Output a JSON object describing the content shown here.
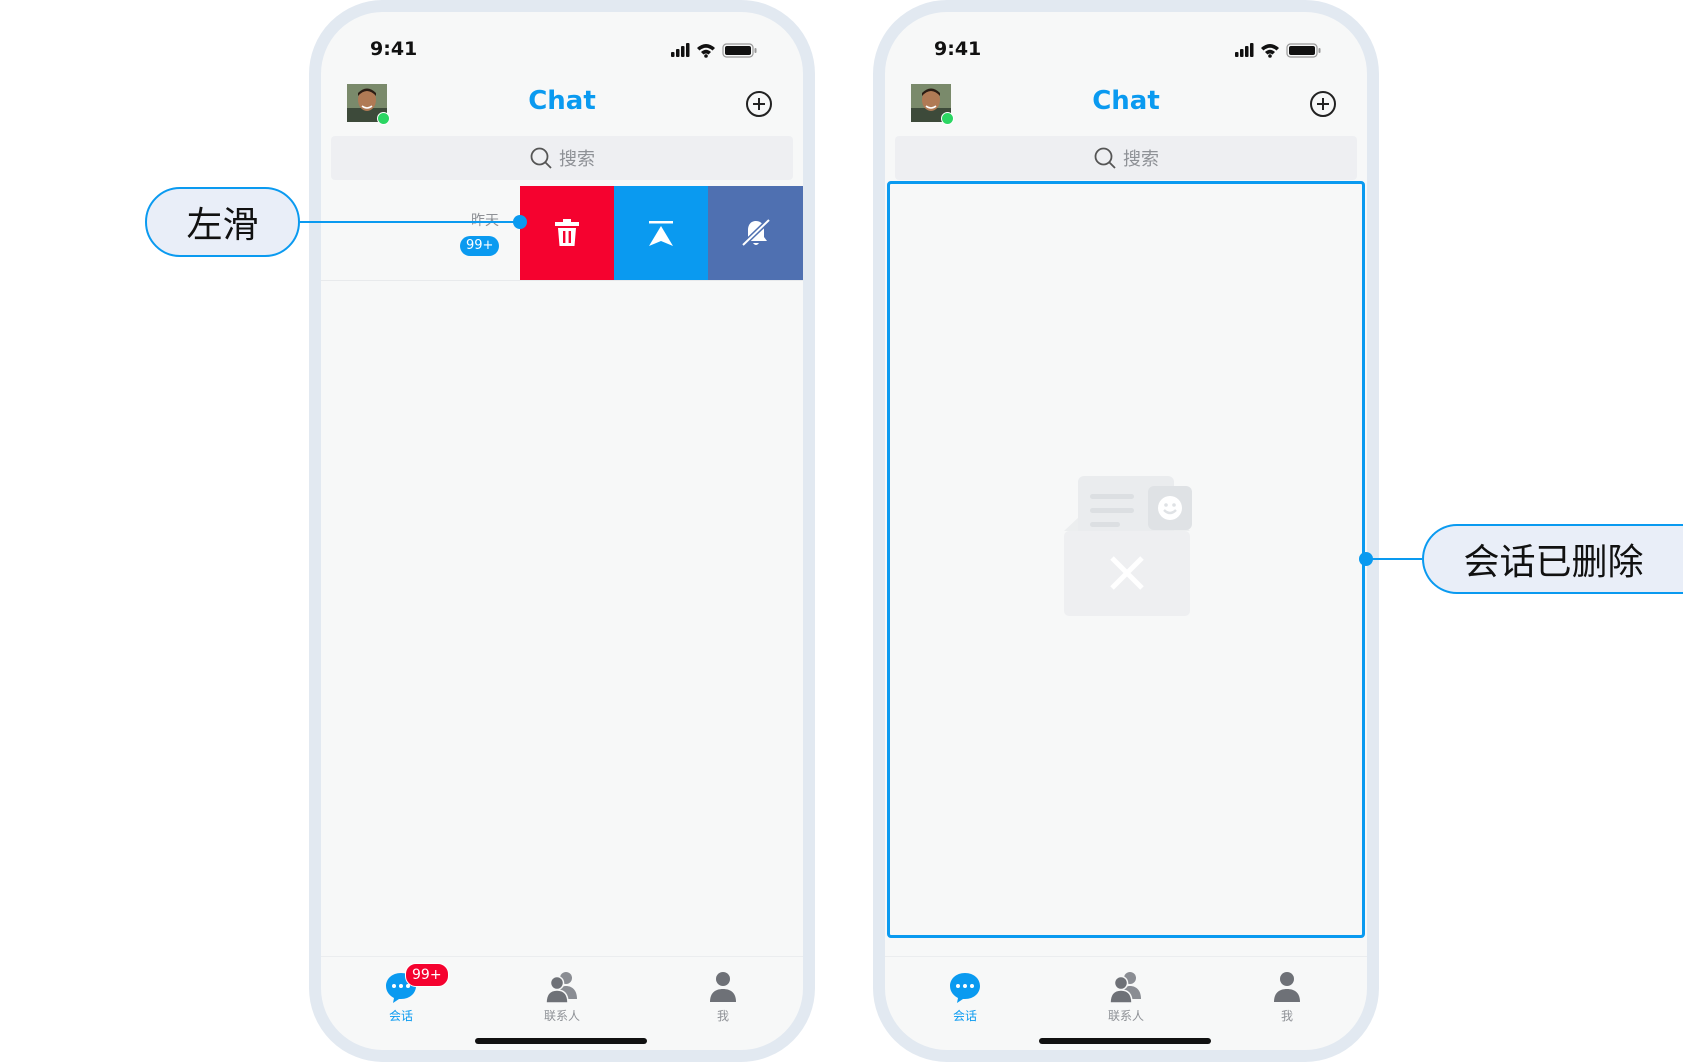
{
  "colors": {
    "accent": "#0a9af0",
    "delete": "#f5022f",
    "mute": "#4f70b1",
    "badge": "#f5022f",
    "online": "#2bd663"
  },
  "left_screen": {
    "status_time": "9:41",
    "title": "Chat",
    "search_placeholder": "搜索",
    "conversation": {
      "time": "昨天",
      "unread_badge": "99+"
    },
    "swipe_actions": [
      {
        "icon": "trash-icon"
      },
      {
        "icon": "pin-to-top-icon"
      },
      {
        "icon": "mute-bell-icon"
      }
    ],
    "tabs": [
      {
        "label": "会话",
        "icon": "chat-bubble-icon",
        "badge": "99+",
        "active": true
      },
      {
        "label": "联系人",
        "icon": "contacts-icon"
      },
      {
        "label": "我",
        "icon": "person-icon"
      }
    ]
  },
  "right_screen": {
    "status_time": "9:41",
    "title": "Chat",
    "search_placeholder": "搜索",
    "empty_state_icon": "empty-inbox-icon",
    "tabs": [
      {
        "label": "会话",
        "icon": "chat-bubble-icon",
        "active": true
      },
      {
        "label": "联系人",
        "icon": "contacts-icon"
      },
      {
        "label": "我",
        "icon": "person-icon"
      }
    ]
  },
  "callouts": {
    "swipe_left": "左滑",
    "conversation_deleted": "会话已删除"
  }
}
